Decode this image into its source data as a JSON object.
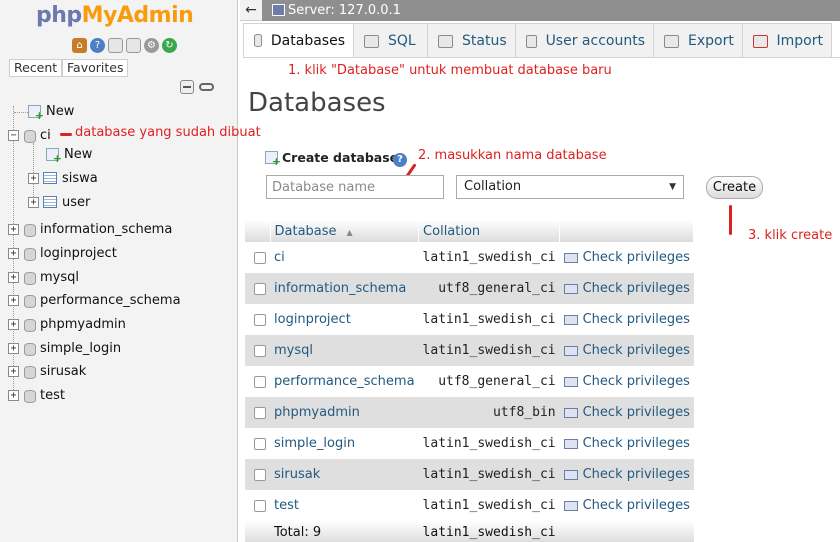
{
  "nav": {
    "logo_php": "php",
    "logo_myadmin": "MyAdmin",
    "recent_label": "Recent",
    "favorites_label": "Favorites",
    "tree": [
      {
        "label": "New",
        "kind": "new"
      },
      {
        "label": "ci",
        "kind": "db",
        "expanded": true,
        "children": [
          {
            "label": "New",
            "kind": "new"
          },
          {
            "label": "siswa",
            "kind": "table"
          },
          {
            "label": "user",
            "kind": "table"
          }
        ]
      },
      {
        "label": "information_schema",
        "kind": "db"
      },
      {
        "label": "loginproject",
        "kind": "db"
      },
      {
        "label": "mysql",
        "kind": "db"
      },
      {
        "label": "performance_schema",
        "kind": "db"
      },
      {
        "label": "phpmyadmin",
        "kind": "db"
      },
      {
        "label": "simple_login",
        "kind": "db"
      },
      {
        "label": "sirusak",
        "kind": "db"
      },
      {
        "label": "test",
        "kind": "db"
      }
    ]
  },
  "topbar": {
    "back_symbol": "←",
    "server_label": "Server: 127.0.0.1"
  },
  "tabs": [
    {
      "label": "Databases",
      "active": true
    },
    {
      "label": "SQL",
      "active": false
    },
    {
      "label": "Status",
      "active": false
    },
    {
      "label": "User accounts",
      "active": false
    },
    {
      "label": "Export",
      "active": false
    },
    {
      "label": "Import",
      "active": false
    }
  ],
  "main": {
    "title": "Databases",
    "create_label": "Create database",
    "dbname_placeholder": "Database name",
    "collation_value": "Collation",
    "create_button": "Create"
  },
  "table": {
    "headers": {
      "database": "Database",
      "collation": "Collation"
    },
    "rows": [
      {
        "name": "ci",
        "collation": "latin1_swedish_ci",
        "action": "Check privileges"
      },
      {
        "name": "information_schema",
        "collation": "utf8_general_ci",
        "action": "Check privileges"
      },
      {
        "name": "loginproject",
        "collation": "latin1_swedish_ci",
        "action": "Check privileges"
      },
      {
        "name": "mysql",
        "collation": "latin1_swedish_ci",
        "action": "Check privileges"
      },
      {
        "name": "performance_schema",
        "collation": "utf8_general_ci",
        "action": "Check privileges"
      },
      {
        "name": "phpmyadmin",
        "collation": "utf8_bin",
        "action": "Check privileges"
      },
      {
        "name": "simple_login",
        "collation": "latin1_swedish_ci",
        "action": "Check privileges"
      },
      {
        "name": "sirusak",
        "collation": "latin1_swedish_ci",
        "action": "Check privileges"
      },
      {
        "name": "test",
        "collation": "latin1_swedish_ci",
        "action": "Check privileges"
      }
    ],
    "total_label": "Total: 9",
    "total_collation": "latin1_swedish_ci"
  },
  "annotations": {
    "step1": "1. klik \"Database\" untuk membuat database baru",
    "existing_db": "database yang sudah dibuat",
    "step2": "2. masukkan nama database",
    "step3": "3. klik create",
    "color": "#e02020"
  }
}
